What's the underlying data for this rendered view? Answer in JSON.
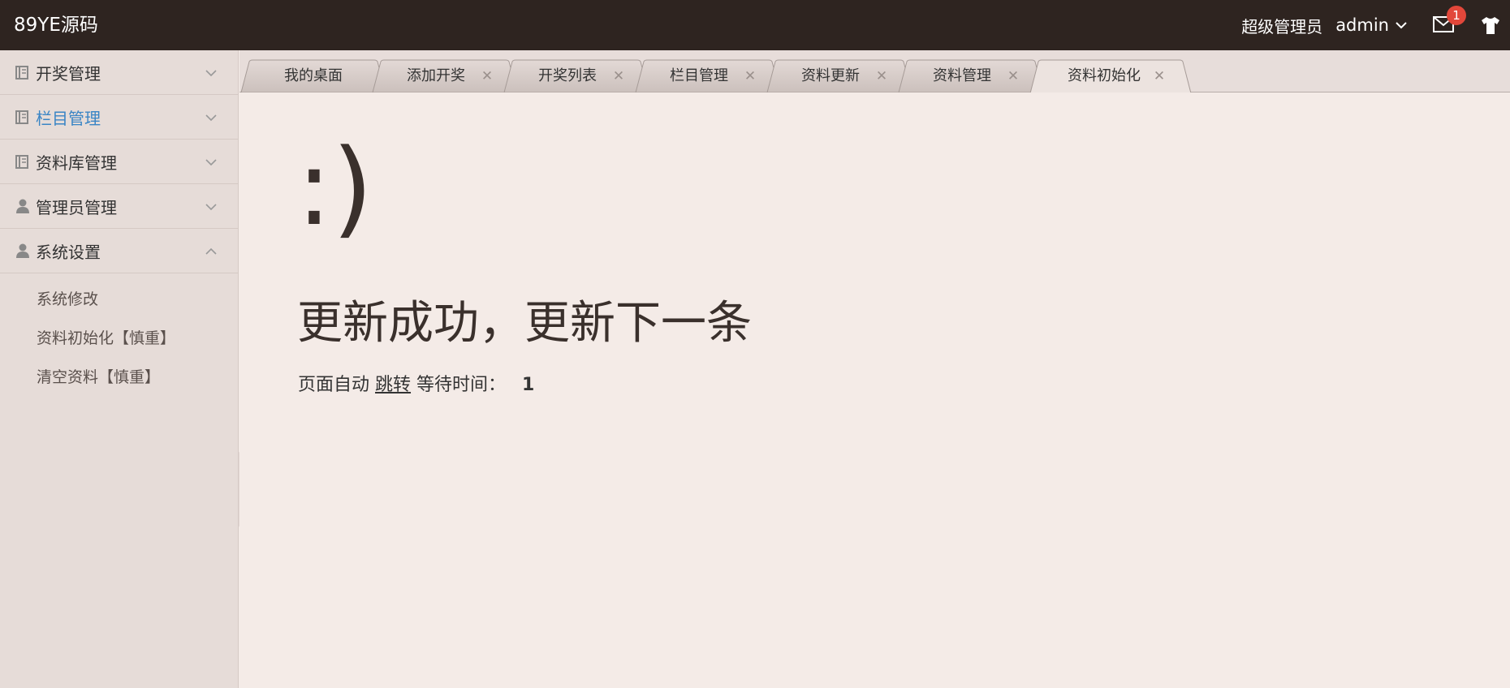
{
  "header": {
    "logo": "89YE源码",
    "role": "超级管理员",
    "username": "admin",
    "mail_badge": "1"
  },
  "sidebar": {
    "items": [
      {
        "label": "开奖管理",
        "icon": "book-icon",
        "expanded": false
      },
      {
        "label": "栏目管理",
        "icon": "book-icon",
        "expanded": false,
        "active": true
      },
      {
        "label": "资料库管理",
        "icon": "book-icon",
        "expanded": false
      },
      {
        "label": "管理员管理",
        "icon": "user-icon",
        "expanded": false
      },
      {
        "label": "系统设置",
        "icon": "user-icon",
        "expanded": true
      }
    ],
    "subitems": [
      "系统修改",
      "资料初始化【慎重】",
      "清空资料【慎重】"
    ]
  },
  "tabs": [
    {
      "label": "我的桌面",
      "closable": false
    },
    {
      "label": "添加开奖",
      "closable": true
    },
    {
      "label": "开奖列表",
      "closable": true
    },
    {
      "label": "栏目管理",
      "closable": true
    },
    {
      "label": "资料更新",
      "closable": true
    },
    {
      "label": "资料管理",
      "closable": true
    },
    {
      "label": "资料初始化",
      "closable": true,
      "active": true
    }
  ],
  "main": {
    "smiley": ":)",
    "message": "更新成功，更新下一条",
    "redirect_prefix": "页面自动",
    "redirect_link": "跳转",
    "redirect_wait_label": "等待时间：",
    "redirect_seconds": "1"
  },
  "colors": {
    "topbar": "#2e2420",
    "sidebar": "#e6dcd8",
    "content": "#f4ebe7",
    "active_text": "#3a85c5",
    "badge": "#e2473a"
  }
}
